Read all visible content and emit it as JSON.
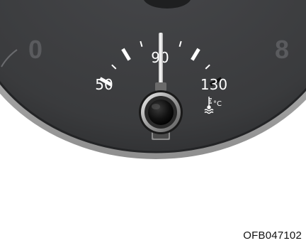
{
  "gauge": {
    "name": "coolant-temperature-gauge",
    "unit_symbol": "°C",
    "scale_labels": [
      "50",
      "90",
      "130"
    ],
    "neighbor_labels": [
      "0",
      "8"
    ],
    "pointer_value": 90,
    "colors": {
      "face": "#3b3c3e",
      "face_edge": "#2c2d2f",
      "bezel": "#c9c9c9",
      "ticks": "#ffffff",
      "hot_tick": "#111111",
      "labels": "#ffffff",
      "dim_labels": "#5a5b5e",
      "background": "#ffffff"
    }
  },
  "figure_code": "OFB047102"
}
